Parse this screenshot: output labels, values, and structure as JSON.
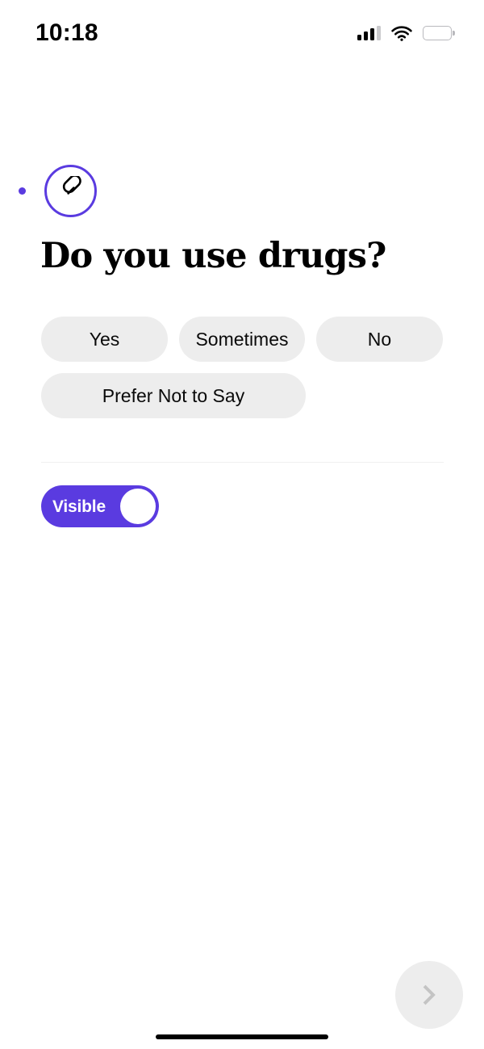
{
  "status_bar": {
    "time": "10:18",
    "signal_icon": "cellular-signal-icon",
    "wifi_icon": "wifi-icon",
    "battery_icon": "battery-low-icon",
    "battery_level_percent": 10,
    "battery_color": "#f3341f"
  },
  "theme": {
    "accent": "#5a3be0",
    "chip_bg": "#ededed",
    "text": "#000000",
    "page_bg": "#ffffff",
    "muted": "#c4c4c4"
  },
  "prompt_card": {
    "carousel_dot_icon": "carousel-dot",
    "topic_icon": "pill-capsule-icon",
    "question": "Do you use drugs?",
    "options": [
      {
        "label": "Yes",
        "selected": false,
        "width_class": "w-yes"
      },
      {
        "label": "Sometimes",
        "selected": false,
        "width_class": "w-sometimes"
      },
      {
        "label": "No",
        "selected": false,
        "width_class": "w-no"
      },
      {
        "label": "Prefer Not to Say",
        "selected": false,
        "width_class": "w-prefer"
      }
    ]
  },
  "visibility": {
    "label": "Visible",
    "state": "on",
    "knob_icon": "toggle-knob"
  },
  "navigation": {
    "next_label": "",
    "next_icon": "chevron-right-icon",
    "next_enabled": false
  },
  "home_indicator": {
    "icon": "home-indicator-bar"
  }
}
